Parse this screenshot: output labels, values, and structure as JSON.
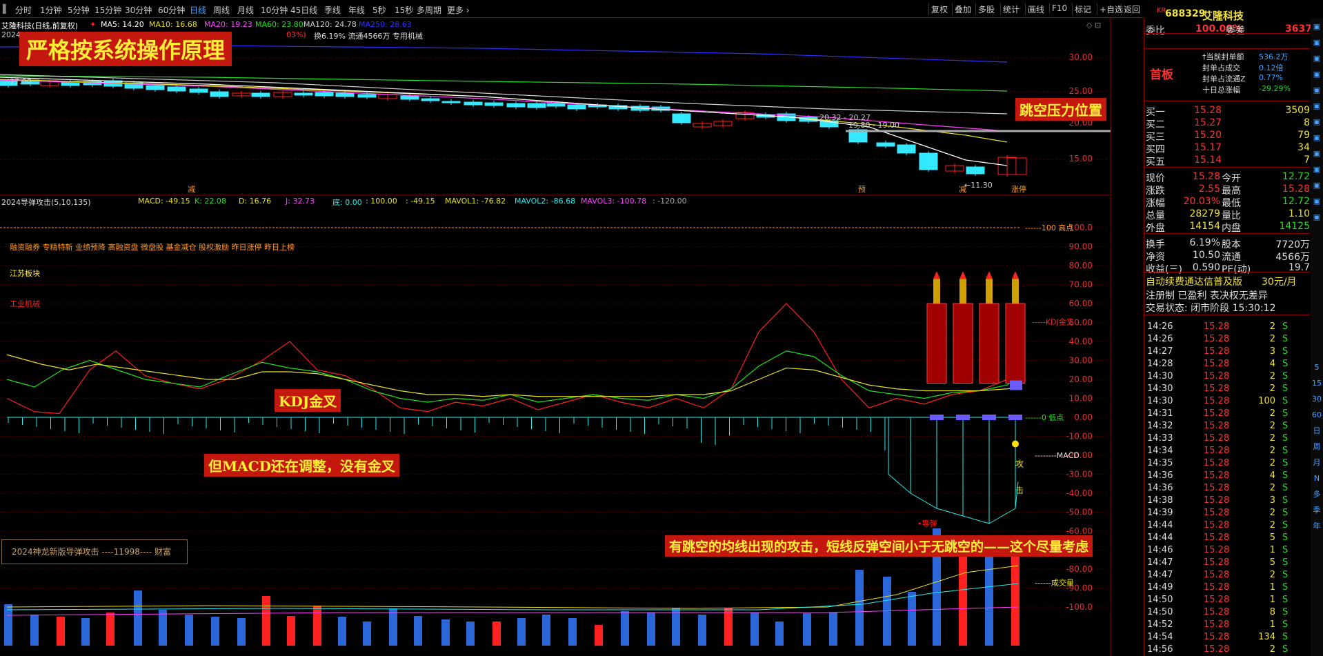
{
  "tabs": [
    "分时",
    "1分钟",
    "5分钟",
    "15分钟",
    "30分钟",
    "60分钟",
    "日线",
    "周线",
    "月线",
    "10分钟",
    "45日线",
    "季线",
    "年线",
    "5秒",
    "15秒",
    "多周期",
    "更多 ›"
  ],
  "active_tab": "日线",
  "toolbar_right": [
    "复权",
    "叠加",
    "多股",
    "统计",
    "画线",
    "F10",
    "标记",
    "+自选",
    "返回"
  ],
  "stock_title": "艾隆科技(日线,前复权)",
  "ma_legend": {
    "ma5": "MA5: 14.20",
    "ma10": "MA10: 16.68",
    "ma20": "MA20: 19.23",
    "ma60": "MA60: 23.80",
    "ma120": "MA120: 24.78",
    "ma250": "MA250: 28.63"
  },
  "info_line": "换6.19% 流通4566万 专用机械",
  "info_prefix": "2024",
  "info_pct": "03%)",
  "main_axis": [
    "30.00",
    "25.00",
    "20.00",
    "15.00"
  ],
  "price_annots": {
    "a1": "20.32 - 20.27",
    "a2": "19.80 - 19.00",
    "a3": "27.00",
    "low": "←11.30"
  },
  "chart_tags": {
    "t1": "减",
    "t2": "预",
    "t3": "减",
    "t4": "涨停"
  },
  "indicator_title": "2024导弹攻击(5,10,135)",
  "indicator_legend": {
    "macd": "MACD: -49.15",
    "k": "K: 22.08",
    "d": "D: 16.76",
    "j": "J: 32.73",
    "di": "底: 0.00",
    "top": ": 100.00",
    "v1": ": -49.15",
    "mavol1": "MAVOL1: -76.82",
    "mavol2": "MAVOL2: -86.68",
    "mavol3": "MAVOL3: -100.78",
    "v2": ": -120.00"
  },
  "ind_axis": [
    "100.0",
    "90.00",
    "80.00",
    "70.00",
    "60.00",
    "50.00",
    "40.00",
    "30.00",
    "20.00",
    "10.00",
    "0.00",
    "-10.00",
    "-20.00",
    "-30.00",
    "-40.00",
    "-50.00",
    "-60.00",
    "-70.00",
    "-80.00",
    "-90.00",
    "-100.0"
  ],
  "sector_tags": "融资融券 专精特新 业绩预降 高融资盘 微盘股 基金减仓 股权激励 昨日涨停 昨日上榜",
  "sector_region": "江苏板块",
  "sector_industry": "工业机械",
  "ind_labels": {
    "high": "100 高点",
    "kdj": "KDJ金叉",
    "low": "0 低点",
    "macd": "MACD",
    "vol": "成交量",
    "daodan": "•导弹",
    "gong": "攻",
    "ji": "击"
  },
  "callouts": {
    "title": "严格按系统操作原理",
    "gap": "跳空压力位置",
    "kdj": "KDJ金叉",
    "macd": "但MACD还在调整，没有金叉",
    "bottom": "有跳空的均线出现的攻击，短线反弹空间小于无跳空的——这个尽量考虑"
  },
  "brand_box": "2024神龙新版导弹攻击 ----11998---- 财富",
  "panel": {
    "code": "688329",
    "name": "艾隆科技",
    "kr": "KR",
    "weibi_label": "委比",
    "weibi_val": "100.00%",
    "weicha_label": "委差",
    "weicha_val": "3637",
    "board": "首板",
    "seal": [
      [
        "†当前封单额",
        "536.2万"
      ],
      [
        "封单占成交",
        "0.12倍"
      ],
      [
        "封单占流通Z",
        "0.77%"
      ],
      [
        "十日总涨幅",
        "-29.29%"
      ]
    ],
    "bids": [
      [
        "买一",
        "15.28",
        "3509"
      ],
      [
        "买二",
        "15.27",
        "8"
      ],
      [
        "买三",
        "15.20",
        "79"
      ],
      [
        "买四",
        "15.17",
        "34"
      ],
      [
        "买五",
        "15.14",
        "7"
      ]
    ],
    "quote": [
      [
        "现价",
        "15.28",
        "今开",
        "12.72"
      ],
      [
        "涨跌",
        "2.55",
        "最高",
        "15.28"
      ],
      [
        "涨幅",
        "20.03%",
        "最低",
        "12.72"
      ],
      [
        "总量",
        "28279",
        "量比",
        "1.10"
      ],
      [
        "外盘",
        "14154",
        "内盘",
        "14125"
      ]
    ],
    "stats": [
      [
        "换手",
        "6.19%",
        "股本",
        "7720万"
      ],
      [
        "净资",
        "10.50",
        "流通",
        "4566万"
      ],
      [
        "收益(三)",
        "0.590",
        "PE(动)",
        "19.7"
      ]
    ],
    "promo": "自动续费通达信普及版",
    "promo_price": "30元/月",
    "reg": "注册制 已盈利 表决权无差异",
    "trade_state": "交易状态: 闭市阶段 15:30:12",
    "ticks": [
      [
        "14:26",
        "15.28",
        "2",
        "S"
      ],
      [
        "14:26",
        "15.28",
        "2",
        "S"
      ],
      [
        "14:27",
        "15.28",
        "3",
        "S"
      ],
      [
        "14:28",
        "15.28",
        "4",
        "S"
      ],
      [
        "14:30",
        "15.28",
        "2",
        "S"
      ],
      [
        "14:30",
        "15.28",
        "2",
        "S"
      ],
      [
        "14:30",
        "15.28",
        "100",
        "S"
      ],
      [
        "14:31",
        "15.28",
        "2",
        "S"
      ],
      [
        "14:32",
        "15.28",
        "2",
        "S"
      ],
      [
        "14:33",
        "15.28",
        "2",
        "S"
      ],
      [
        "14:34",
        "15.28",
        "2",
        "S"
      ],
      [
        "14:35",
        "15.28",
        "2",
        "S"
      ],
      [
        "14:36",
        "15.28",
        "4",
        "S"
      ],
      [
        "14:36",
        "15.28",
        "2",
        "S"
      ],
      [
        "14:38",
        "15.28",
        "3",
        "S"
      ],
      [
        "14:39",
        "15.28",
        "2",
        "S"
      ],
      [
        "14:44",
        "15.28",
        "2",
        "S"
      ],
      [
        "14:44",
        "15.28",
        "5",
        "S"
      ],
      [
        "14:46",
        "15.28",
        "1",
        "S"
      ],
      [
        "14:47",
        "15.28",
        "5",
        "S"
      ],
      [
        "14:47",
        "15.28",
        "2",
        "S"
      ],
      [
        "14:49",
        "15.28",
        "1",
        "S"
      ],
      [
        "14:50",
        "15.28",
        "1",
        "S"
      ],
      [
        "14:50",
        "15.28",
        "8",
        "S"
      ],
      [
        "14:52",
        "15.28",
        "1",
        "S"
      ],
      [
        "14:54",
        "15.28",
        "134",
        "S"
      ],
      [
        "14:56",
        "15.28",
        "2",
        "S"
      ]
    ]
  },
  "side_icons": [
    "5",
    "15",
    "30",
    "60",
    "日",
    "周",
    "月",
    "N",
    "多",
    "季",
    "年"
  ],
  "colors": {
    "up": "#ff2020",
    "down": "#34e8ff",
    "ma5": "#ffffff",
    "ma10": "#e8e020",
    "ma20": "#ff40ff",
    "ma60": "#20e020",
    "ma120": "#cfcfcf",
    "ma250": "#3030ff"
  }
}
